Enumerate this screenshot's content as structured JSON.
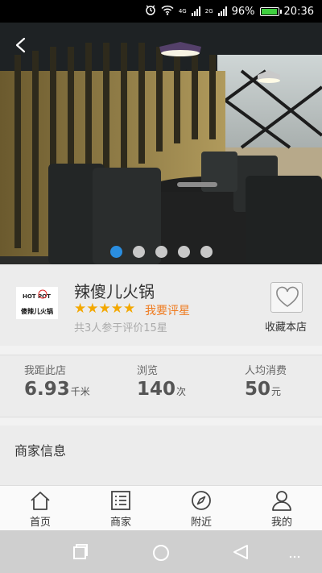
{
  "status_bar": {
    "battery_percent": "96%",
    "time": "20:36",
    "network_tags": [
      "4G",
      "2G"
    ],
    "icons": [
      "alarm-icon",
      "wifi-icon",
      "signal-icon",
      "battery-icon"
    ]
  },
  "hero": {
    "icons": [
      "back-arrow-icon"
    ],
    "carousel": {
      "count": 5,
      "active_index": 0
    },
    "colors": {
      "active_dot": "#2a8ee0",
      "dot": "#c8c8c8"
    }
  },
  "store": {
    "logo_text_top": "HOT POT",
    "logo_text_bottom": "傻辣儿火锅",
    "name": "辣傻儿火锅",
    "stars": "★★★★★",
    "rating_value": 5,
    "rate_link": "我要评星",
    "rating_summary": "共3人参于评价15星",
    "favorite_label": "收藏本店",
    "colors": {
      "star": "#f3a800",
      "rate_link": "#ef7a1e"
    }
  },
  "stats": {
    "distance": {
      "label": "我距此店",
      "value": "6.93",
      "unit": "千米"
    },
    "views": {
      "label": "浏览",
      "value": "140",
      "unit": "次"
    },
    "avg_spend": {
      "label": "人均消费",
      "value": "50",
      "unit": "元"
    }
  },
  "merchant": {
    "title": "商家信息"
  },
  "tabbar": {
    "tabs": [
      {
        "label": "首页",
        "icon": "home-icon"
      },
      {
        "label": "商家",
        "icon": "list-icon"
      },
      {
        "label": "附近",
        "icon": "compass-icon"
      },
      {
        "label": "我的",
        "icon": "user-icon"
      }
    ]
  },
  "nav_bar": {
    "icons": [
      "recent-apps-icon",
      "home-circle-icon",
      "back-triangle-icon",
      "more-dots-icon"
    ]
  }
}
